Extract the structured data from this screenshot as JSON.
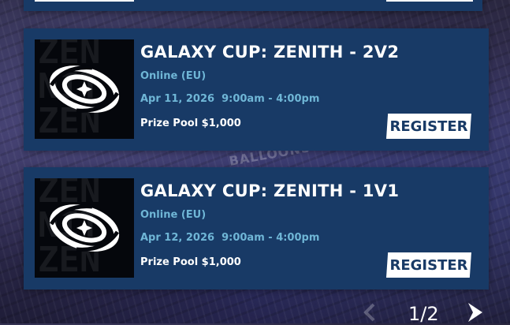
{
  "background": {
    "banner_text": "BALLOONS"
  },
  "tournaments": [
    {
      "title": "GALAXY CUP: ZENITH - 2V2",
      "location": "Online (EU)",
      "date": "Apr 11, 2026  9:00am - 4:00pm",
      "prize": "Prize Pool $1,000",
      "register_label": "REGISTER",
      "thumb_letters": "ZENI\nTHZE\nNITH"
    },
    {
      "title": "GALAXY CUP: ZENITH - 1V1",
      "location": "Online (EU)",
      "date": "Apr 12, 2026  9:00am - 4:00pm",
      "prize": "Prize Pool $1,000",
      "register_label": "REGISTER",
      "thumb_letters": "ZENI\nTHZE\nNITH"
    }
  ],
  "pagination": {
    "label": "1/2"
  },
  "colors": {
    "card": "#183a66",
    "accent_text": "#6fb6d6",
    "button": "#ffffff"
  },
  "icons": {
    "logo": "galaxy-swirl-icon",
    "next": "chevron-right-icon"
  }
}
